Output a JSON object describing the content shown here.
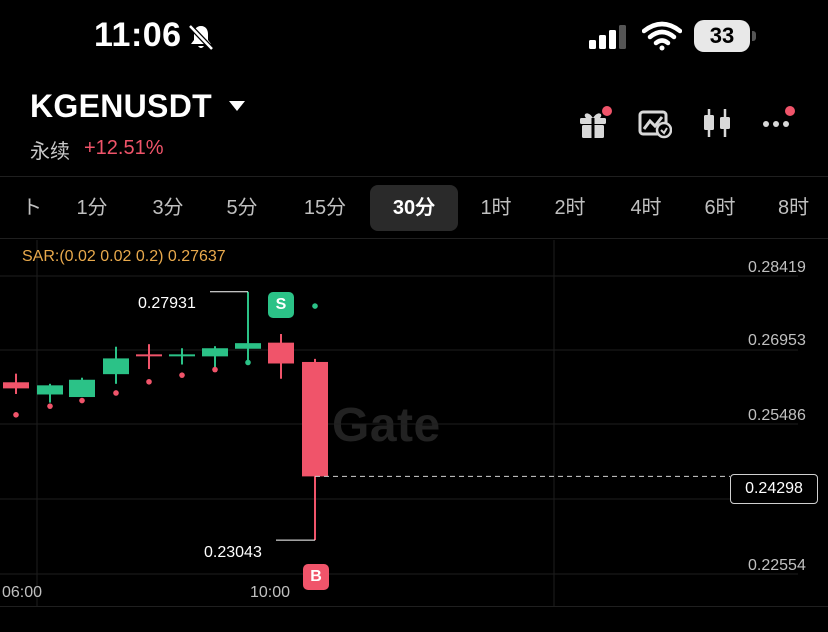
{
  "status_bar": {
    "time": "11:06",
    "battery": "33"
  },
  "header": {
    "pair": "KGENUSDT",
    "contract_type": "永续",
    "change": "+12.51%"
  },
  "tabs": [
    "1分",
    "3分",
    "5分",
    "15分",
    "30分",
    "1时",
    "2时",
    "4时",
    "6时",
    "8时"
  ],
  "active_tab": "30分",
  "chart": {
    "indicator_label": "SAR:(0.02 0.02 0.2) 0.27637",
    "y_labels": [
      "0.28419",
      "0.26953",
      "0.25486",
      "0.22554"
    ],
    "x_labels": [
      "06:00",
      "10:00"
    ],
    "current_price": "0.24298",
    "high_callout": "0.27931",
    "low_callout": "0.23043",
    "sell_marker": "S",
    "buy_marker": "B",
    "watermark": "Gate"
  },
  "colors": {
    "up": "#2bc287",
    "down": "#f0546a",
    "sar_label": "#e8a94c"
  },
  "chart_data": {
    "type": "candlestick",
    "interval": "30分",
    "candles": [
      {
        "open": 0.2615,
        "high": 0.2632,
        "low": 0.2592,
        "close": 0.2603
      },
      {
        "open": 0.2591,
        "high": 0.2612,
        "low": 0.2575,
        "close": 0.2609
      },
      {
        "open": 0.2586,
        "high": 0.2624,
        "low": 0.2586,
        "close": 0.262
      },
      {
        "open": 0.2631,
        "high": 0.2685,
        "low": 0.2612,
        "close": 0.2662
      },
      {
        "open": 0.267,
        "high": 0.269,
        "low": 0.2641,
        "close": 0.2668
      },
      {
        "open": 0.2669,
        "high": 0.2682,
        "low": 0.265,
        "close": 0.267
      },
      {
        "open": 0.2666,
        "high": 0.2686,
        "low": 0.2636,
        "close": 0.2682
      },
      {
        "open": 0.2681,
        "high": 0.27931,
        "low": 0.265,
        "close": 0.2692
      },
      {
        "open": 0.2693,
        "high": 0.271,
        "low": 0.2622,
        "close": 0.2652
      },
      {
        "open": 0.2655,
        "high": 0.2661,
        "low": 0.23043,
        "close": 0.24298
      }
    ],
    "sar": [
      0.2551,
      0.2568,
      0.2579,
      0.2594,
      0.2616,
      0.2629,
      0.264,
      0.2654,
      0.2765,
      0.2765
    ],
    "ylim": [
      0.2224,
      0.2889
    ]
  }
}
